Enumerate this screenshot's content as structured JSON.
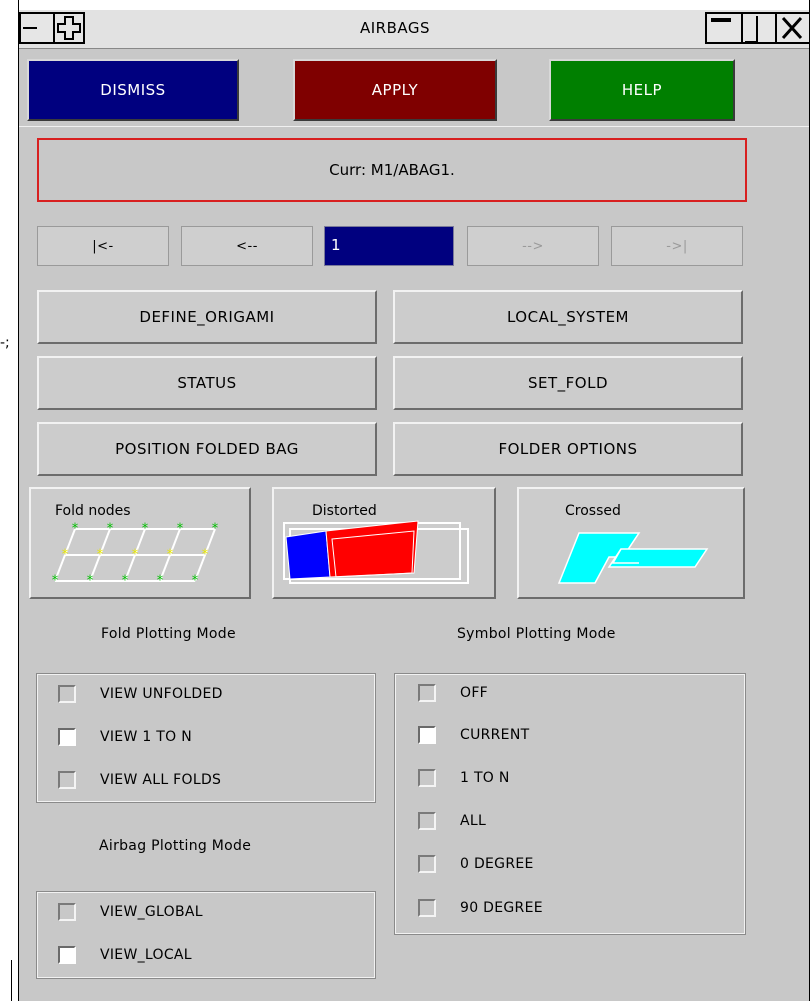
{
  "window": {
    "title": "AIRBAGS",
    "stray_text": "-;"
  },
  "actions": {
    "dismiss": "DISMISS",
    "apply": "APPLY",
    "help": "HELP"
  },
  "current": "Curr: M1/ABAG1.",
  "nav": {
    "first": "|<-",
    "prev": "<--",
    "value": "1",
    "next": "-->",
    "last": "->|"
  },
  "tools": {
    "define_origami": "DEFINE_ORIGAMI",
    "local_system": "LOCAL_SYSTEM",
    "status": "STATUS",
    "set_fold": "SET_FOLD",
    "position_folded_bag": "POSITION FOLDED BAG",
    "folder_options": "FOLDER OPTIONS"
  },
  "display_modes": {
    "fold_nodes": "Fold nodes",
    "distorted": "Distorted",
    "crossed": "Crossed"
  },
  "fold_plotting": {
    "heading": "Fold Plotting Mode",
    "options": [
      {
        "label": "VIEW UNFOLDED",
        "checked": false
      },
      {
        "label": "VIEW 1 TO N",
        "checked": true
      },
      {
        "label": "VIEW ALL FOLDS",
        "checked": false
      }
    ]
  },
  "symbol_plotting": {
    "heading": "Symbol Plotting Mode",
    "options": [
      {
        "label": "OFF",
        "checked": false
      },
      {
        "label": "CURRENT",
        "checked": true
      },
      {
        "label": "1 TO N",
        "checked": false
      },
      {
        "label": "ALL",
        "checked": false
      },
      {
        "label": "0 DEGREE",
        "checked": false
      },
      {
        "label": "90 DEGREE",
        "checked": false
      }
    ]
  },
  "airbag_plotting": {
    "heading": "Airbag Plotting Mode",
    "options": [
      {
        "label": "VIEW_GLOBAL",
        "checked": false
      },
      {
        "label": "VIEW_LOCAL",
        "checked": true
      }
    ]
  },
  "colors": {
    "dismiss": "#00007f",
    "apply": "#7f0000",
    "help": "#007f00",
    "current_border": "#d82020"
  }
}
